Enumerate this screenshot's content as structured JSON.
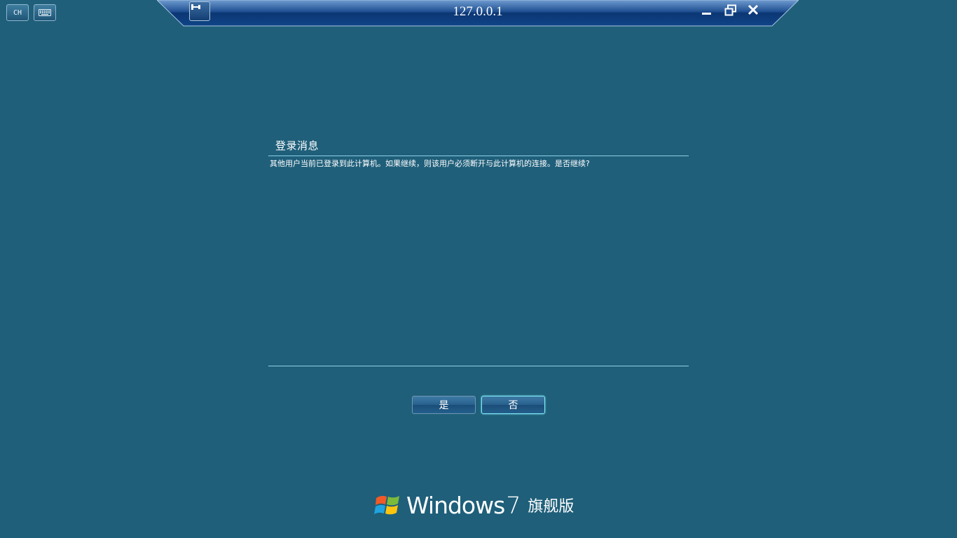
{
  "top_left": {
    "lang_label": "CH",
    "keyboard_icon": "keyboard-icon"
  },
  "connection_bar": {
    "title": "127.0.0.1",
    "pin_icon": "pin-icon",
    "minimize_icon": "minimize-icon",
    "restore_icon": "restore-icon",
    "close_icon": "close-icon"
  },
  "dialog": {
    "title": "登录消息",
    "message": "其他用户当前已登录到此计算机。如果继续，则该用户必须断开与此计算机的连接。是否继续?",
    "yes_label": "是",
    "no_label": "否"
  },
  "branding": {
    "word": "Windows",
    "version": "7",
    "edition": "旗舰版"
  },
  "colors": {
    "background": "#1f5f7a",
    "bar": "#0f3f7e",
    "focus": "#7ee8f6"
  }
}
